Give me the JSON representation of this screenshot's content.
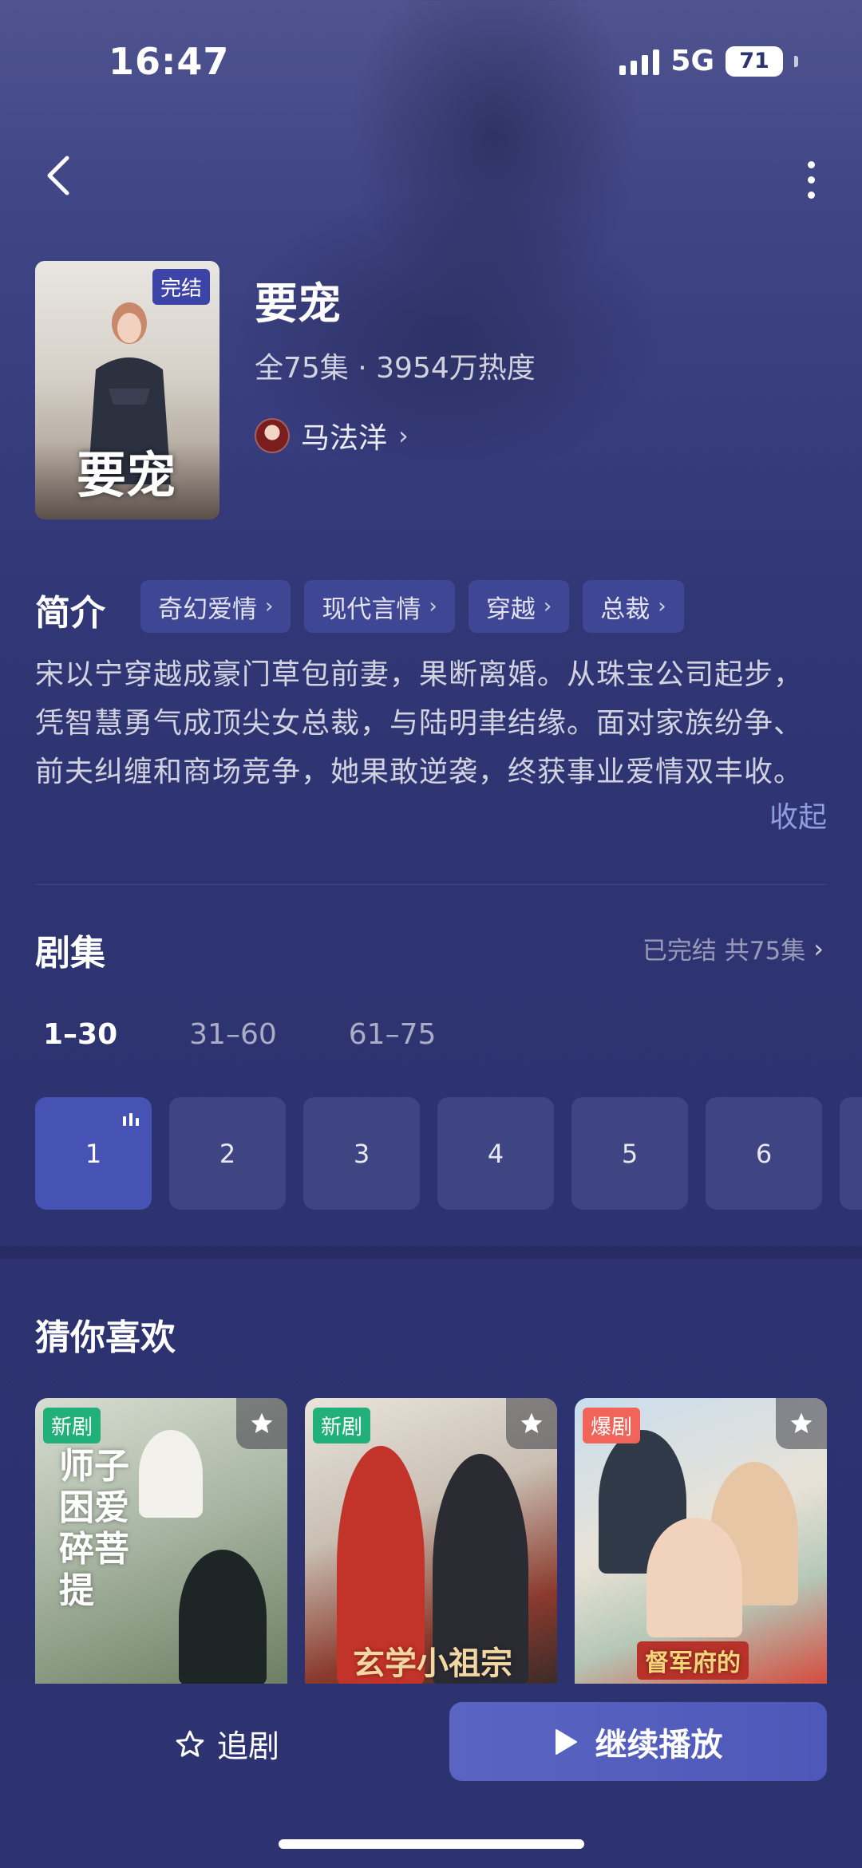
{
  "status_bar": {
    "time": "16:47",
    "network": "5G",
    "battery": "71",
    "battery_level": 0.71
  },
  "show": {
    "badge": "完结",
    "poster_title": "要宠",
    "title": "要宠",
    "meta": "全75集 · 3954万热度",
    "actor": "马法洋"
  },
  "intro": {
    "heading": "简介",
    "tags": [
      "奇幻爱情",
      "现代言情",
      "穿越",
      "总裁"
    ],
    "text": "宋以宁穿越成豪门草包前妻，果断离婚。从珠宝公司起步，凭智慧勇气成顶尖女总裁，与陆明聿结缘。面对家族纷争、前夫纠缠和商场竞争，她果敢逆袭，终获事业爱情双丰收。",
    "collapse": "收起"
  },
  "episodes": {
    "heading": "剧集",
    "status": "已完结 共75集",
    "ranges": [
      "1–30",
      "31–60",
      "61–75"
    ],
    "list": [
      "1",
      "2",
      "3",
      "4",
      "5",
      "6"
    ]
  },
  "recommend": {
    "heading": "猜你喜欢",
    "cards": [
      {
        "badge": "新剧",
        "art_text": "师子困爱碎菩提"
      },
      {
        "badge": "新剧",
        "art_text": "玄学小祖宗"
      },
      {
        "badge": "爆剧",
        "art_text": "督军府的"
      }
    ]
  },
  "bottom": {
    "follow": "追剧",
    "continue": "继续播放"
  },
  "icons": [
    "back-icon",
    "more-icon",
    "chevron-right-icon",
    "star-outline-icon",
    "star-icon",
    "play-icon",
    "signal-icon",
    "battery-icon"
  ]
}
